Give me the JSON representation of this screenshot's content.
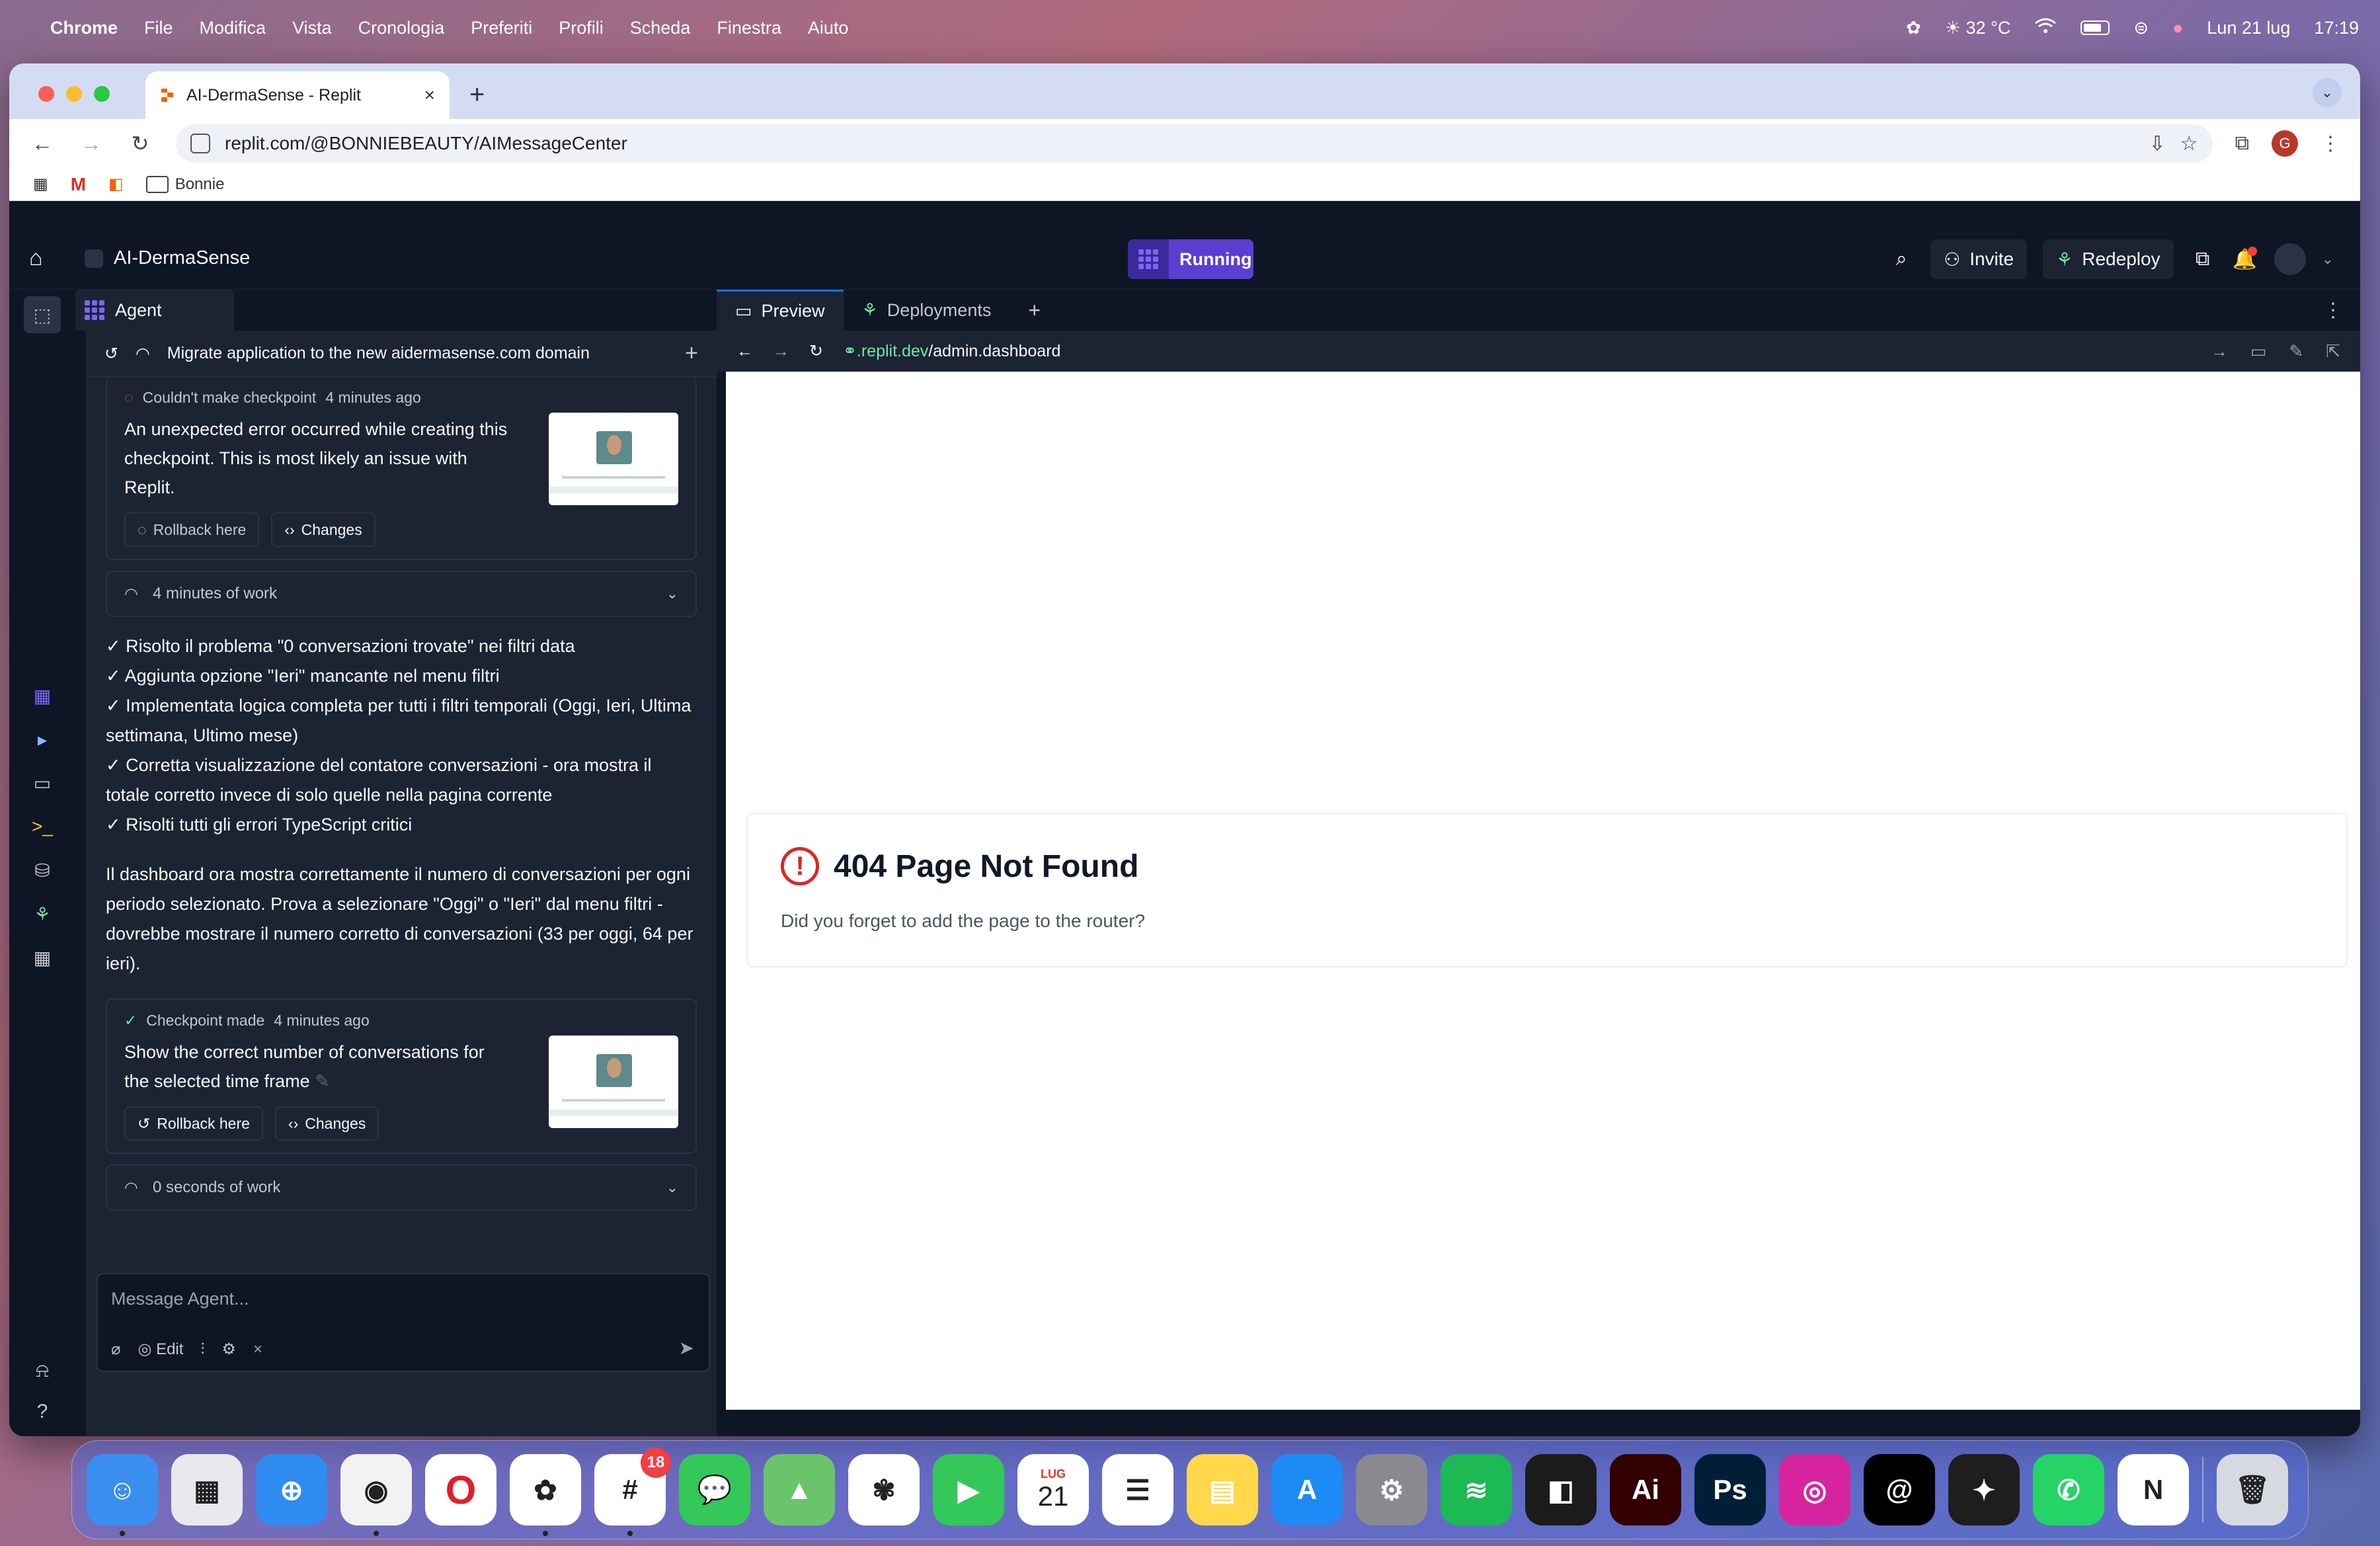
{
  "menubar": {
    "app": "Chrome",
    "items": [
      "File",
      "Modifica",
      "Vista",
      "Cronologia",
      "Preferiti",
      "Profili",
      "Scheda",
      "Finestra",
      "Aiuto"
    ],
    "weather": "32 °C",
    "date": "Lun 21 lug",
    "time": "17:19"
  },
  "browser": {
    "tab_title": "AI-DermaSense - Replit",
    "url": "replit.com/@BONNIEBEAUTY/AIMessageCenter",
    "profile_initial": "G",
    "bookmark_folder": "Bonnie"
  },
  "replit": {
    "project_name": "AI-DermaSense",
    "run_status": "Running",
    "invite_label": "Invite",
    "redeploy_label": "Redeploy"
  },
  "agent": {
    "tab_label": "Agent",
    "thread_title": "Migrate application to the new aidermasense.com domain",
    "checkpoint1": {
      "status": "Couldn't make checkpoint",
      "time": "4 minutes ago",
      "message": "An unexpected error occurred while creating this checkpoint. This is most likely an issue with Replit.",
      "rollback": "Rollback here",
      "changes": "Changes"
    },
    "work1": "4 minutes of work",
    "bullets": [
      "✓ Risolto il problema \"0 conversazioni trovate\" nei filtri data",
      "✓ Aggiunta opzione \"Ieri\" mancante nel menu filtri",
      "✓ Implementata logica completa per tutti i filtri temporali (Oggi, Ieri, Ultima settimana, Ultimo mese)",
      "✓ Corretta visualizzazione del contatore conversazioni - ora mostra il totale corretto invece di solo quelle nella pagina corrente",
      "✓ Risolti tutti gli errori TypeScript critici"
    ],
    "summary": "Il dashboard ora mostra correttamente il numero di conversazioni per ogni periodo selezionato. Prova a selezionare \"Oggi\" o \"Ieri\" dal menu filtri - dovrebbe mostrare il numero corretto di conversazioni (33 per oggi, 64 per ieri).",
    "checkpoint2": {
      "status": "Checkpoint made",
      "time": "4 minutes ago",
      "message": "Show the correct number of conversations for the selected time frame",
      "rollback": "Rollback here",
      "changes": "Changes"
    },
    "work2": "0 seconds of work",
    "composer_placeholder": "Message Agent...",
    "edit_label": "Edit"
  },
  "preview": {
    "tabs": [
      "Preview",
      "Deployments"
    ],
    "url_domain": ".replit.dev",
    "url_path": "/admin.dashboard",
    "error_title": "404 Page Not Found",
    "error_subtitle": "Did you forget to add the page to the router?"
  },
  "dock": {
    "apps": [
      {
        "name": "Finder",
        "color": "#3a8ef0",
        "glyph": "☺",
        "running": true
      },
      {
        "name": "Launchpad",
        "color": "#e8e8ee",
        "glyph": "▦",
        "running": false
      },
      {
        "name": "Safari",
        "color": "#2f8cf0",
        "glyph": "⊕",
        "running": false
      },
      {
        "name": "Chrome",
        "color": "#f2f2f2",
        "glyph": "◉",
        "running": true
      },
      {
        "name": "Opera",
        "color": "#e01f26",
        "glyph": "O",
        "running": false
      },
      {
        "name": "ChatGPT",
        "color": "#ffffff",
        "glyph": "✿",
        "running": true
      },
      {
        "name": "Slack",
        "color": "#ffffff",
        "glyph": "#",
        "running": true,
        "badge": "18"
      },
      {
        "name": "Messages",
        "color": "#34c759",
        "glyph": "💬",
        "running": false
      },
      {
        "name": "Maps",
        "color": "#6ac46a",
        "glyph": "▲",
        "running": false
      },
      {
        "name": "Photos",
        "color": "#ffffff",
        "glyph": "✾",
        "running": false
      },
      {
        "name": "FaceTime",
        "color": "#34c759",
        "glyph": "▶",
        "running": false
      },
      {
        "name": "Calendar",
        "color": "#ffffff",
        "glyph": "21",
        "running": false
      },
      {
        "name": "Reminders",
        "color": "#ffffff",
        "glyph": "☰",
        "running": false
      },
      {
        "name": "Notes",
        "color": "#ffd94a",
        "glyph": "▤",
        "running": false
      },
      {
        "name": "App Store",
        "color": "#1e8af5",
        "glyph": "A",
        "running": false
      },
      {
        "name": "System Settings",
        "color": "#8a8a8e",
        "glyph": "⚙",
        "running": false
      },
      {
        "name": "Spotify",
        "color": "#1db954",
        "glyph": "≋",
        "running": false
      },
      {
        "name": "Replit",
        "color": "#1b1b1b",
        "glyph": "◧",
        "running": false
      },
      {
        "name": "Illustrator",
        "color": "#330000",
        "glyph": "Ai",
        "running": false
      },
      {
        "name": "Photoshop",
        "color": "#001e36",
        "glyph": "Ps",
        "running": false
      },
      {
        "name": "Instagram",
        "color": "#d6249f",
        "glyph": "◎",
        "running": false
      },
      {
        "name": "Threads",
        "color": "#000000",
        "glyph": "@",
        "running": false
      },
      {
        "name": "Figma",
        "color": "#1e1e1e",
        "glyph": "✦",
        "running": false
      },
      {
        "name": "WhatsApp",
        "color": "#25d366",
        "glyph": "✆",
        "running": false
      },
      {
        "name": "Notion",
        "color": "#ffffff",
        "glyph": "N",
        "running": false
      },
      {
        "name": "Trash",
        "color": "#d6d9e0",
        "glyph": "🗑",
        "running": false
      }
    ],
    "calendar_month": "LUG"
  },
  "colors": {
    "accent": "#5a3fd0",
    "panel": "#1c2333",
    "background": "#0e1525",
    "error": "#dc2626"
  }
}
